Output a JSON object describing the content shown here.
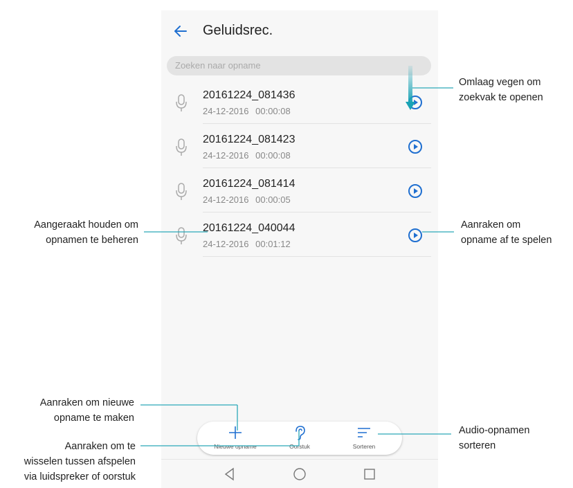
{
  "app": {
    "title": "Geluidsrec.",
    "search_placeholder": "Zoeken naar opname"
  },
  "recordings": [
    {
      "name": "20161224_081436",
      "date": "24-12-2016",
      "duration": "00:00:08"
    },
    {
      "name": "20161224_081423",
      "date": "24-12-2016",
      "duration": "00:00:08"
    },
    {
      "name": "20161224_081414",
      "date": "24-12-2016",
      "duration": "00:00:05"
    },
    {
      "name": "20161224_040044",
      "date": "24-12-2016",
      "duration": "00:01:12"
    }
  ],
  "toolbar": {
    "new_label": "Nieuwe opname",
    "earpiece_label": "Oorstuk",
    "sort_label": "Sorteren"
  },
  "annotations": {
    "swipe_1": "Omlaag vegen om",
    "swipe_2": "zoekvak te openen",
    "hold_1": "Aangeraakt houden om",
    "hold_2": "opnamen te beheren",
    "play_1": "Aanraken om",
    "play_2": "opname af te spelen",
    "new_1": "Aanraken om nieuwe",
    "new_2": "opname te maken",
    "switch_1": "Aanraken om te",
    "switch_2": "wisselen tussen afspelen",
    "switch_3": "via luidspreker of oorstuk",
    "sort_1": "Audio-opnamen",
    "sort_2": "sorteren"
  },
  "colors": {
    "accent": "#1f6fd0",
    "swipe_arrow": "#1aa3b5",
    "callout_line": "#2ba8b8"
  }
}
